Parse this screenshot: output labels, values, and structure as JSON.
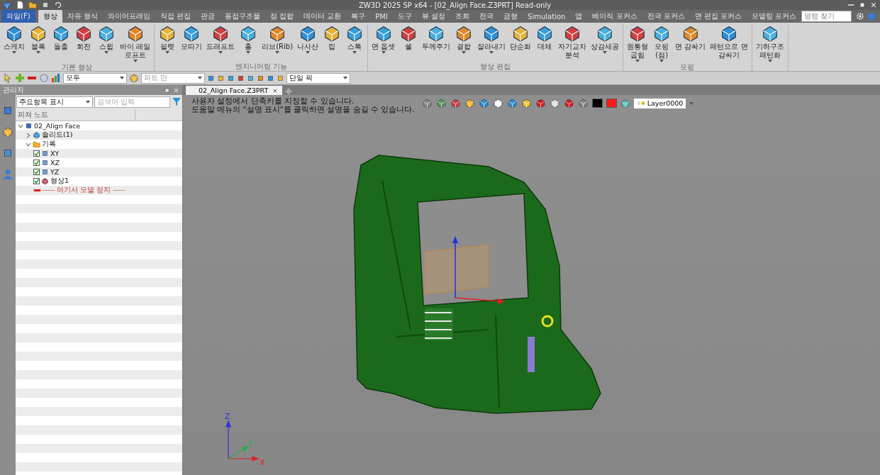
{
  "window": {
    "title": "ZW3D 2025 SP x64 - [02_Align Face.Z3PRT] Read-only"
  },
  "menu_tabs": [
    {
      "label": "파일(F)",
      "kind": "file",
      "selected": false
    },
    {
      "label": "형상",
      "kind": "tab",
      "selected": true
    },
    {
      "label": "자유 형식",
      "kind": "tab",
      "selected": false
    },
    {
      "label": "와이어프레임",
      "kind": "tab",
      "selected": false
    },
    {
      "label": "직접 편집",
      "kind": "tab",
      "selected": false
    },
    {
      "label": "판금",
      "kind": "tab",
      "selected": false
    },
    {
      "label": "용접구조물",
      "kind": "tab",
      "selected": false
    },
    {
      "label": "점 집합",
      "kind": "tab",
      "selected": false
    },
    {
      "label": "데이터 교환",
      "kind": "tab",
      "selected": false
    },
    {
      "label": "복구",
      "kind": "tab",
      "selected": false
    },
    {
      "label": "PMI",
      "kind": "tab",
      "selected": false
    },
    {
      "label": "도구",
      "kind": "tab",
      "selected": false
    },
    {
      "label": "뷰 설정",
      "kind": "tab",
      "selected": false
    },
    {
      "label": "조회",
      "kind": "tab",
      "selected": false
    },
    {
      "label": "전극",
      "kind": "tab",
      "selected": false
    },
    {
      "label": "금형",
      "kind": "tab",
      "selected": false
    },
    {
      "label": "Simulation",
      "kind": "tab",
      "selected": false
    },
    {
      "label": "앱",
      "kind": "tab",
      "selected": false
    },
    {
      "label": "베이직 포커스",
      "kind": "tab",
      "selected": false
    },
    {
      "label": "전극 포커스",
      "kind": "tab",
      "selected": false
    },
    {
      "label": "면 편집 포커스",
      "kind": "tab",
      "selected": false
    },
    {
      "label": "모델링 포커스",
      "kind": "tab",
      "selected": false
    }
  ],
  "command_search": {
    "placeholder": "명령 찾기"
  },
  "ribbon_groups": [
    {
      "title": "기본 형상",
      "buttons": [
        {
          "lines": [
            "스케치"
          ],
          "dropdown": true
        },
        {
          "lines": [
            "블록"
          ],
          "dropdown": true
        },
        {
          "lines": [
            "돌출"
          ],
          "dropdown": false
        },
        {
          "lines": [
            "회전"
          ],
          "dropdown": false
        },
        {
          "lines": [
            "스윕"
          ],
          "dropdown": true
        },
        {
          "lines": [
            "바이 레일",
            "로프트"
          ],
          "dropdown": true
        }
      ]
    },
    {
      "title": "엔지니어링 기능",
      "buttons": [
        {
          "lines": [
            "필렛"
          ],
          "dropdown": true
        },
        {
          "lines": [
            "모따기"
          ],
          "dropdown": false
        },
        {
          "lines": [
            "드래프트"
          ],
          "dropdown": true
        },
        {
          "lines": [
            "홀"
          ],
          "dropdown": true
        },
        {
          "lines": [
            "리브(Rib)"
          ],
          "dropdown": true
        },
        {
          "lines": [
            "나사산"
          ],
          "dropdown": true
        },
        {
          "lines": [
            "립"
          ],
          "dropdown": false
        },
        {
          "lines": [
            "스톡"
          ],
          "dropdown": true
        }
      ]
    },
    {
      "title": "형상 편집",
      "buttons": [
        {
          "lines": [
            "면 옵셋"
          ],
          "dropdown": true
        },
        {
          "lines": [
            "쉘"
          ],
          "dropdown": false
        },
        {
          "lines": [
            "두께주기"
          ],
          "dropdown": false
        },
        {
          "lines": [
            "결합"
          ],
          "dropdown": true
        },
        {
          "lines": [
            "잘라내기"
          ],
          "dropdown": true
        },
        {
          "lines": [
            "단순화"
          ],
          "dropdown": false
        },
        {
          "lines": [
            "대체"
          ],
          "dropdown": false
        },
        {
          "lines": [
            "자기교차",
            "분석"
          ],
          "dropdown": false
        },
        {
          "lines": [
            "상감세공"
          ],
          "dropdown": true
        }
      ]
    },
    {
      "title": "모핑",
      "buttons": [
        {
          "lines": [
            "원통형",
            "굽힘"
          ],
          "dropdown": true
        },
        {
          "lines": [
            "모핑",
            "(점)"
          ],
          "dropdown": true
        },
        {
          "lines": [
            "면 감싸기"
          ],
          "dropdown": false
        },
        {
          "lines": [
            "패턴으로 면",
            "감싸기"
          ],
          "dropdown": false
        }
      ]
    },
    {
      "buttons": [
        {
          "lines": [
            "기하구조",
            "패턴화"
          ],
          "dropdown": true
        }
      ]
    }
  ],
  "selection_toolbar": {
    "filter": {
      "value": "모두",
      "disabled": false
    },
    "scope": {
      "value": "파트 만",
      "disabled": true
    },
    "pick": {
      "value": "단일 픽",
      "disabled": false
    }
  },
  "manager": {
    "title": "관리자",
    "display_mode": "주요항목 표시",
    "search": {
      "placeholder": "검색어 입력"
    },
    "column_header": "피쳐 노드",
    "tree": [
      {
        "label": "02_Align Face",
        "kind": "assembly",
        "expanded": true,
        "children": [
          {
            "label": "솔리드(1)",
            "kind": "solid",
            "expanded": false
          },
          {
            "label": "기록",
            "kind": "folder",
            "expanded": true,
            "children": [
              {
                "label": "XY",
                "kind": "plane",
                "checked": true
              },
              {
                "label": "XZ",
                "kind": "plane",
                "checked": true
              },
              {
                "label": "YZ",
                "kind": "plane",
                "checked": true
              },
              {
                "label": "형상1",
                "kind": "shape",
                "checked": true
              },
              {
                "label": "----- 여기서 모델 정지 -----",
                "kind": "stop"
              }
            ]
          }
        ]
      }
    ]
  },
  "document_tab": {
    "label": "02_Align Face.Z3PRT"
  },
  "hint_lines": [
    "사용자 설정에서 단축키를 지정할 수 있습니다.",
    "도움말 메뉴의 \"설명 표시\"를 클릭하면 설명을 숨길 수 있습니다."
  ],
  "view_toolbar": {
    "swatches": [
      {
        "color": "#000000"
      },
      {
        "color": "#ff1a1a"
      }
    ],
    "layer": "Layer0000"
  },
  "axis_labels": {
    "x": "X",
    "y": "Y",
    "z": "Z"
  }
}
